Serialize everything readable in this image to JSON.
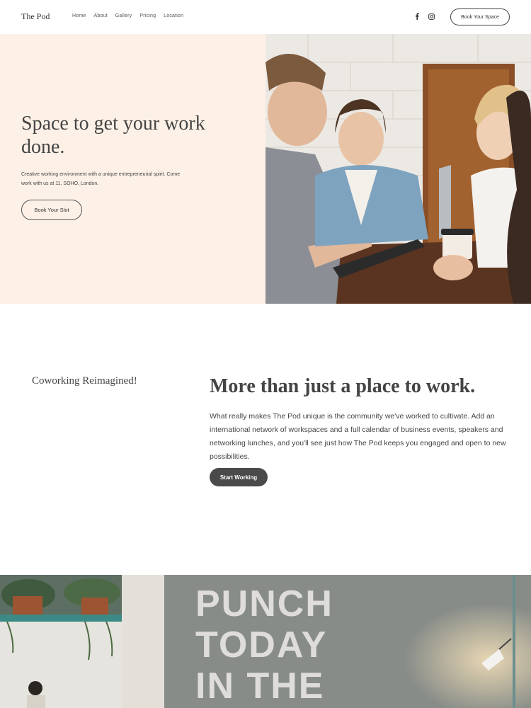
{
  "header": {
    "logo": "The Pod",
    "nav": [
      "Home",
      "About",
      "Gallery",
      "Pricing",
      "Location"
    ],
    "social_icons": [
      "facebook-icon",
      "instagram-icon"
    ],
    "cta_label": "Book Your Space"
  },
  "hero": {
    "title": "Space to get your work done.",
    "subtitle": "Creative working environment with a unique entrepreneurial spirit. Come work with us at 11, SOHO, London.",
    "button_label": "Book Your Slot",
    "bg_color": "#fdf1e7"
  },
  "about": {
    "tagline": "Coworking Reimagined!",
    "title": "More than just a place to work.",
    "body": "What really makes The Pod unique is the community we've worked to cultivate. Add an international network of workspaces and a full calendar of business events, speakers and networking lunches, and you'll see just how The Pod keeps you engaged and open to new possibilities.",
    "button_label": "Start Working"
  },
  "banner": {
    "wall_text_lines": [
      "PUNCH",
      "TODAY",
      "IN THE"
    ]
  }
}
